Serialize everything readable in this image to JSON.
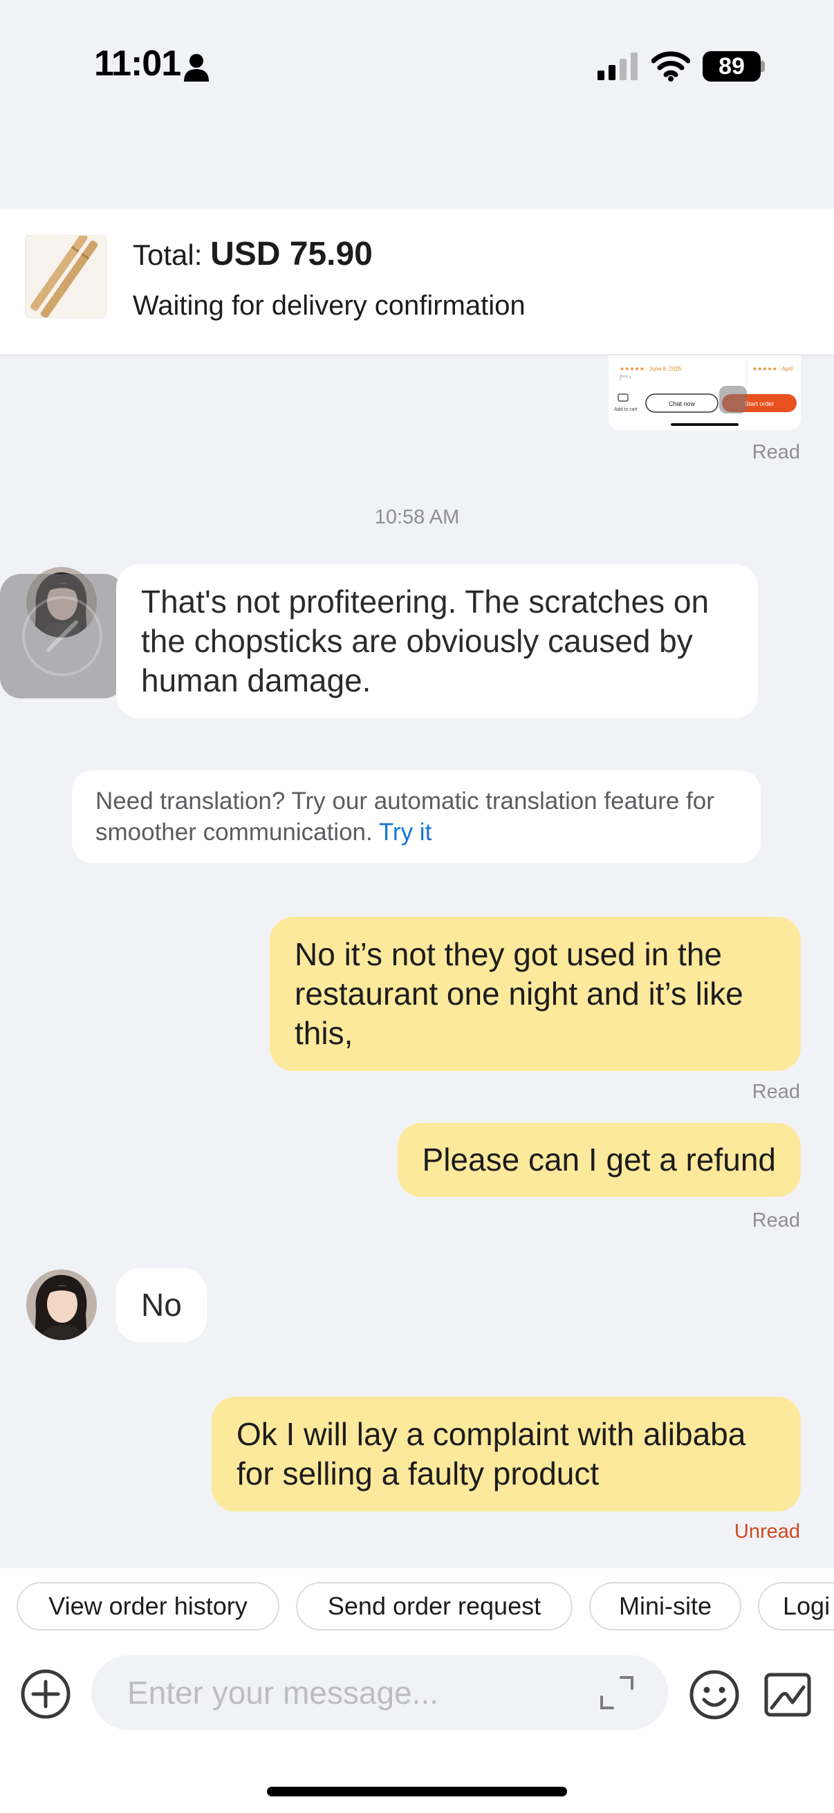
{
  "status_bar": {
    "time": "11:01",
    "battery": "89",
    "icons": [
      "person-icon",
      "cellular-signal-icon",
      "wifi-icon",
      "battery-icon"
    ]
  },
  "order": {
    "total_label": "Total:",
    "total_amount": "USD 75.90",
    "status": "Waiting for delivery confirmation"
  },
  "screenshot_preview": {
    "rating_text_1": "★★★★★ · June 8, 2025",
    "rating_text_2": "★★★★★ · April",
    "add_to_cart": "Add to cart",
    "chat_now": "Chat now",
    "start_order": "Start order"
  },
  "messages": {
    "read_1": "Read",
    "timestamp": "10:58 AM",
    "incoming_1": "That's not profiteering. The scratches on the chopsticks are obviously caused by human damage.",
    "translation_tip": "Need translation? Try our automatic translation feature for smoother communication.",
    "translation_link": "Try it",
    "outgoing_1": "No it’s not they got used in the restaurant one night and it’s like this,",
    "read_2": "Read",
    "outgoing_2": "Please can I get a refund",
    "read_3": "Read",
    "incoming_2": "No",
    "outgoing_3": "Ok I will lay a complaint with alibaba for selling a faulty product",
    "unread": "Unread"
  },
  "quick_actions": [
    "View order history",
    "Send order request",
    "Mini-site",
    "Logi"
  ],
  "composer": {
    "placeholder": "Enter your message...",
    "icons": [
      "plus-icon",
      "expand-icon",
      "emoji-icon",
      "album-icon"
    ]
  },
  "colors": {
    "outgoing_bubble": "#fde99b",
    "incoming_bubble": "#ffffff",
    "background": "#f1f2f6",
    "link": "#1677d2",
    "unread": "#d0481e",
    "start_order": "#e9511e"
  }
}
